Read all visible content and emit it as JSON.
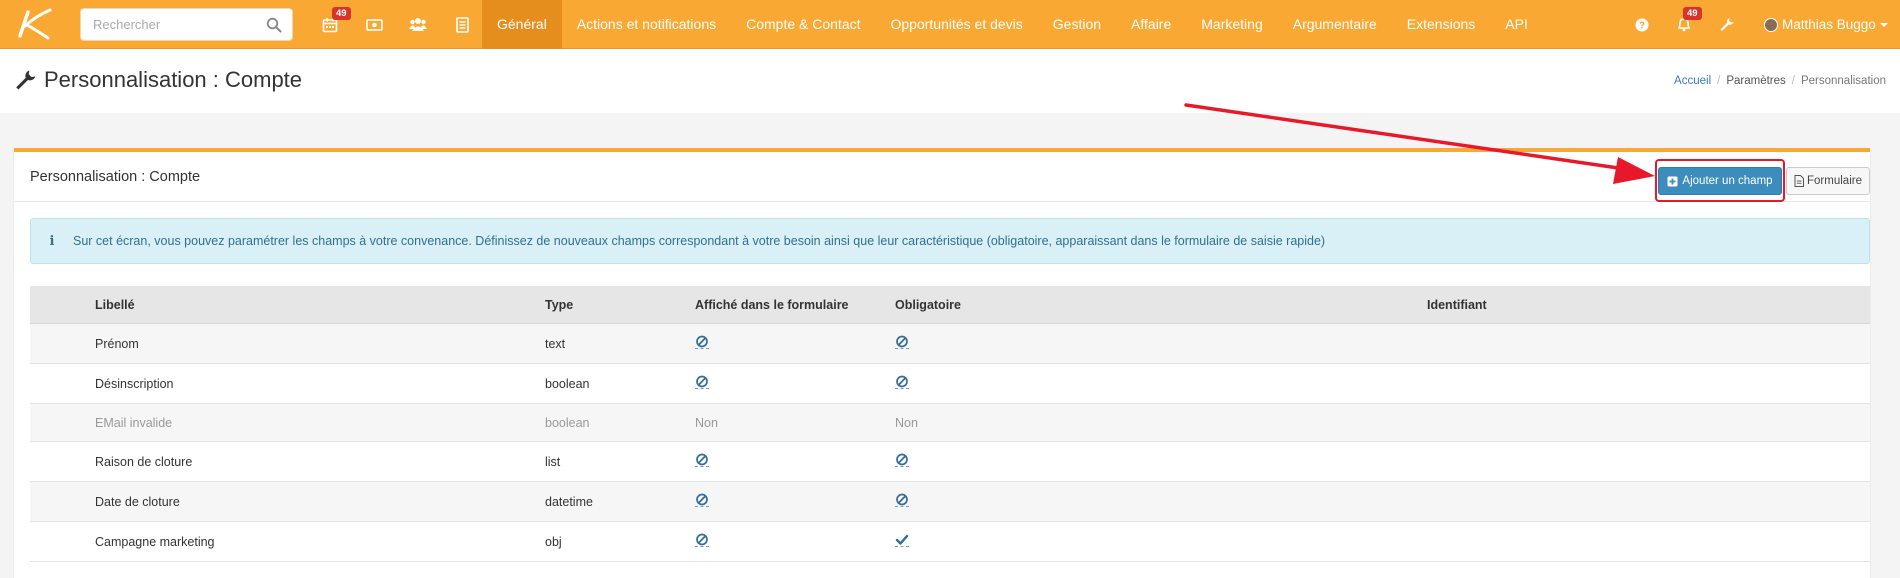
{
  "search": {
    "placeholder": "Rechercher"
  },
  "nav": {
    "badge_calendar": "49",
    "badge_notifications": "49",
    "menu": [
      "Général",
      "Actions et notifications",
      "Compte & Contact",
      "Opportunités et devis",
      "Gestion",
      "Affaire",
      "Marketing",
      "Argumentaire",
      "Extensions",
      "API"
    ],
    "user_name": "Matthias Buggo"
  },
  "page": {
    "title": "Personnalisation : Compte",
    "breadcrumb": [
      "Accueil",
      "Paramètres",
      "Personnalisation"
    ]
  },
  "panel": {
    "title": "Personnalisation : Compte",
    "add_button": "Ajouter un champ",
    "form_button": "Formulaire",
    "info_text": "Sur cet écran, vous pouvez paramétrer les champs à votre convenance. Définissez de nouveaux champs correspondant à votre besoin ainsi que leur caractéristique (obligatoire, apparaissant dans le formulaire de saisie rapide)"
  },
  "table": {
    "headers": [
      "Libellé",
      "Type",
      "Affiché dans le formulaire",
      "Obligatoire",
      "Identifiant"
    ],
    "rows": [
      {
        "label": "Prénom",
        "type": "text",
        "form": "ban-icon",
        "required": "ban-icon"
      },
      {
        "label": "Désinscription",
        "type": "boolean",
        "form": "ban-icon",
        "required": "ban-icon"
      },
      {
        "label": "EMail invalide",
        "type": "boolean",
        "form": "Non",
        "required": "Non"
      },
      {
        "label": "Raison de cloture",
        "type": "list",
        "form": "ban-icon",
        "required": "ban-icon"
      },
      {
        "label": "Date de cloture",
        "type": "datetime",
        "form": "ban-icon",
        "required": "ban-icon"
      },
      {
        "label": "Campagne marketing",
        "type": "obj",
        "form": "ban-icon",
        "required": "check-icon"
      }
    ]
  },
  "colors": {
    "navbar": "#f9a834",
    "nav_active": "#e68e1d",
    "primary_button": "#3c8dbc",
    "annotation": "#e8182b"
  }
}
